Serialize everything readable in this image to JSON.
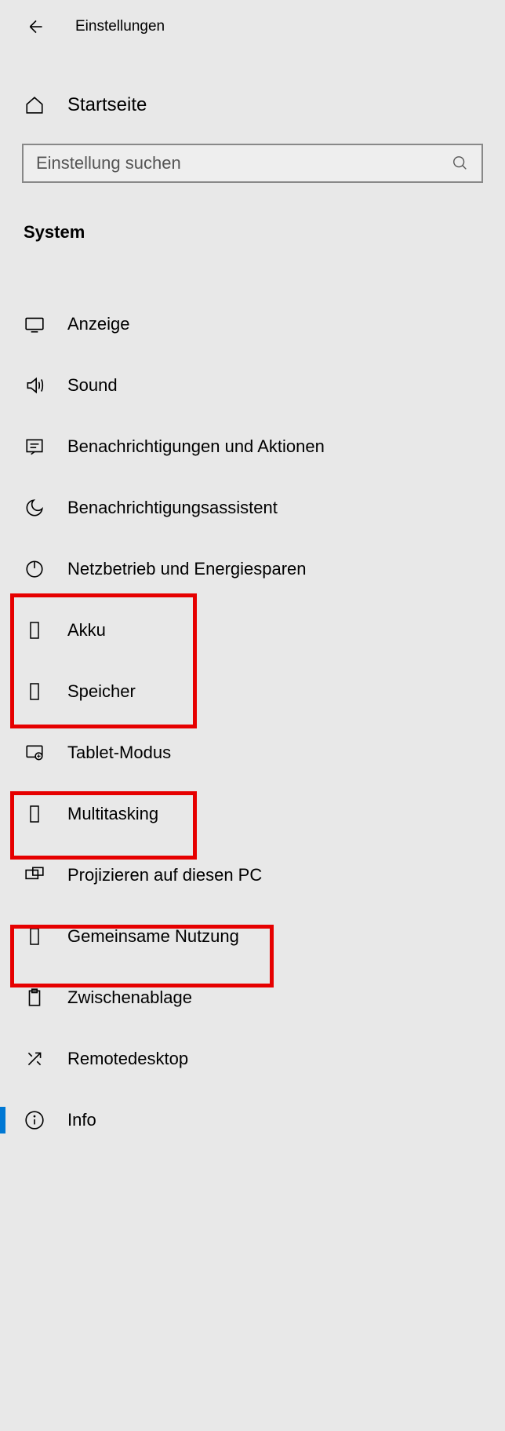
{
  "header": {
    "title": "Einstellungen"
  },
  "home": {
    "label": "Startseite"
  },
  "search": {
    "placeholder": "Einstellung suchen"
  },
  "section": {
    "title": "System"
  },
  "items": [
    {
      "label": "Anzeige",
      "icon": "display"
    },
    {
      "label": "Sound",
      "icon": "sound"
    },
    {
      "label": "Benachrichtigungen und Aktionen",
      "icon": "notification"
    },
    {
      "label": "Benachrichtigungsassistent",
      "icon": "moon"
    },
    {
      "label": "Netzbetrieb und Energiesparen",
      "icon": "power"
    },
    {
      "label": "Akku",
      "icon": "rect"
    },
    {
      "label": "Speicher",
      "icon": "rect"
    },
    {
      "label": "Tablet-Modus",
      "icon": "tablet"
    },
    {
      "label": "Multitasking",
      "icon": "rect"
    },
    {
      "label": "Projizieren auf diesen PC",
      "icon": "project"
    },
    {
      "label": "Gemeinsame Nutzung",
      "icon": "rect"
    },
    {
      "label": "Zwischenablage",
      "icon": "clipboard"
    },
    {
      "label": "Remotedesktop",
      "icon": "remote"
    },
    {
      "label": "Info",
      "icon": "info",
      "selected": true
    }
  ]
}
